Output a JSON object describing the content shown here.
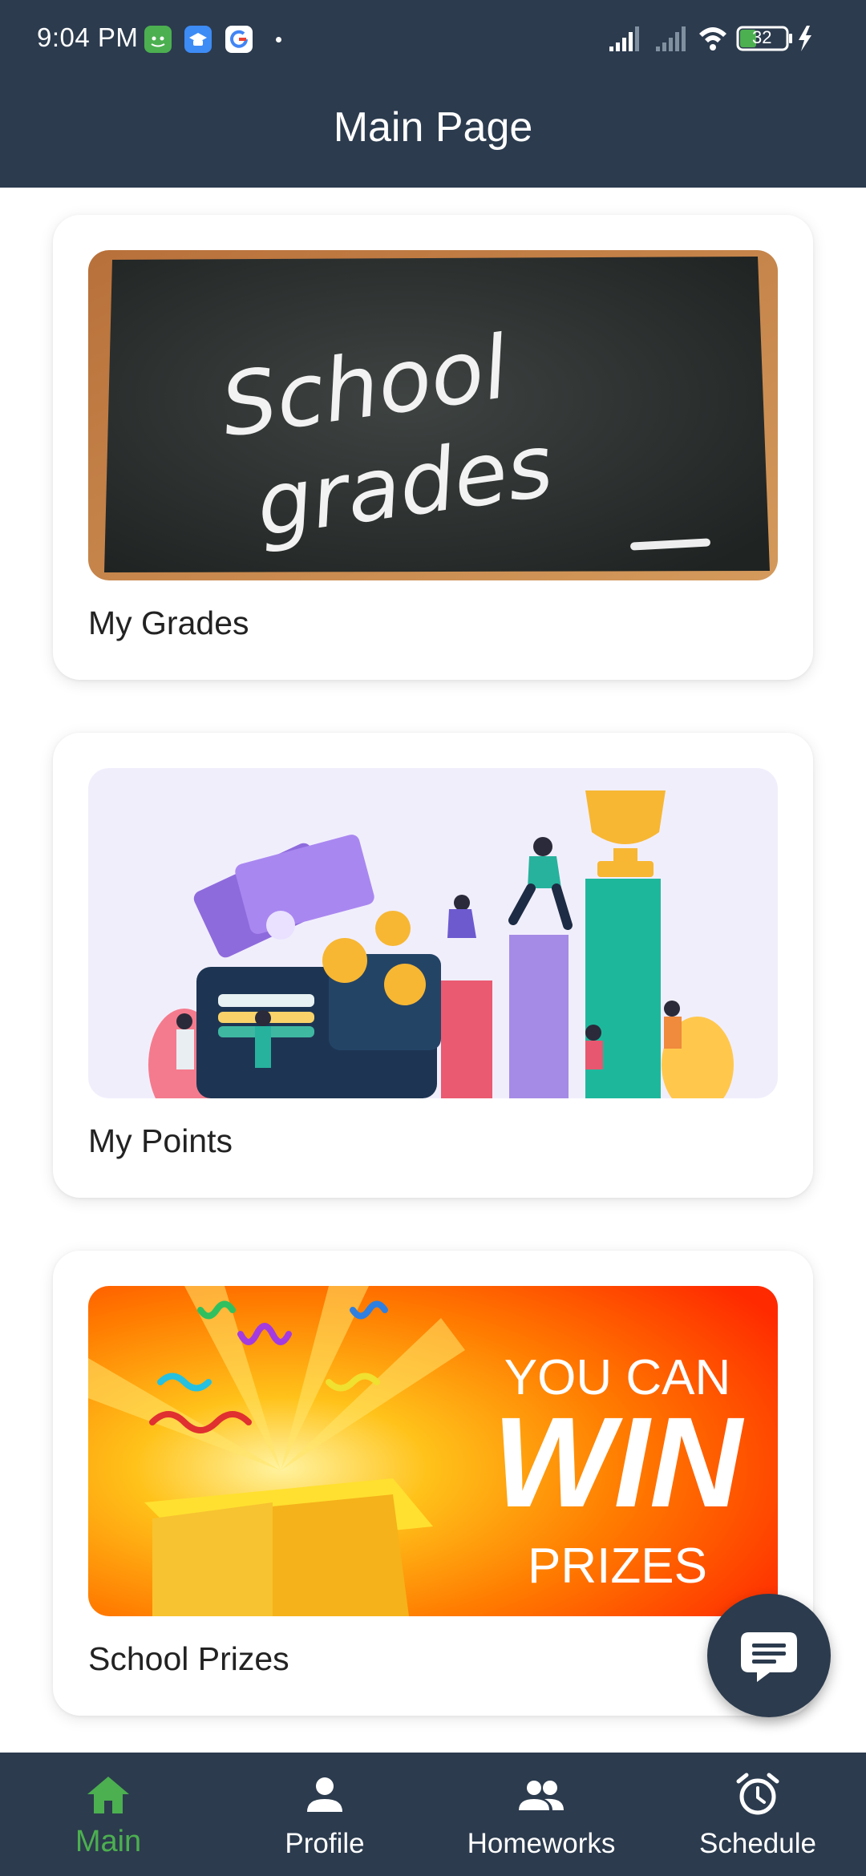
{
  "status_bar": {
    "time": "9:04 PM",
    "battery": "32",
    "notification_icons": [
      "android-icon",
      "school-app-icon",
      "google-icon"
    ]
  },
  "header": {
    "title": "Main Page"
  },
  "cards": [
    {
      "label": "My Grades",
      "image_text": [
        "School",
        "grades"
      ]
    },
    {
      "label": "My Points"
    },
    {
      "label": "School Prizes",
      "image_text": [
        "YOU CAN",
        "WIN",
        "PRIZES"
      ]
    }
  ],
  "fab": {
    "icon": "chat-icon"
  },
  "bottom_nav": {
    "items": [
      {
        "label": "Main",
        "icon": "home-icon",
        "active": true
      },
      {
        "label": "Profile",
        "icon": "person-icon",
        "active": false
      },
      {
        "label": "Homeworks",
        "icon": "group-icon",
        "active": false
      },
      {
        "label": "Schedule",
        "icon": "alarm-icon",
        "active": false
      }
    ]
  },
  "colors": {
    "header_bg": "#2c3b4e",
    "active_nav": "#4caf50",
    "card_bg": "#ffffff"
  }
}
